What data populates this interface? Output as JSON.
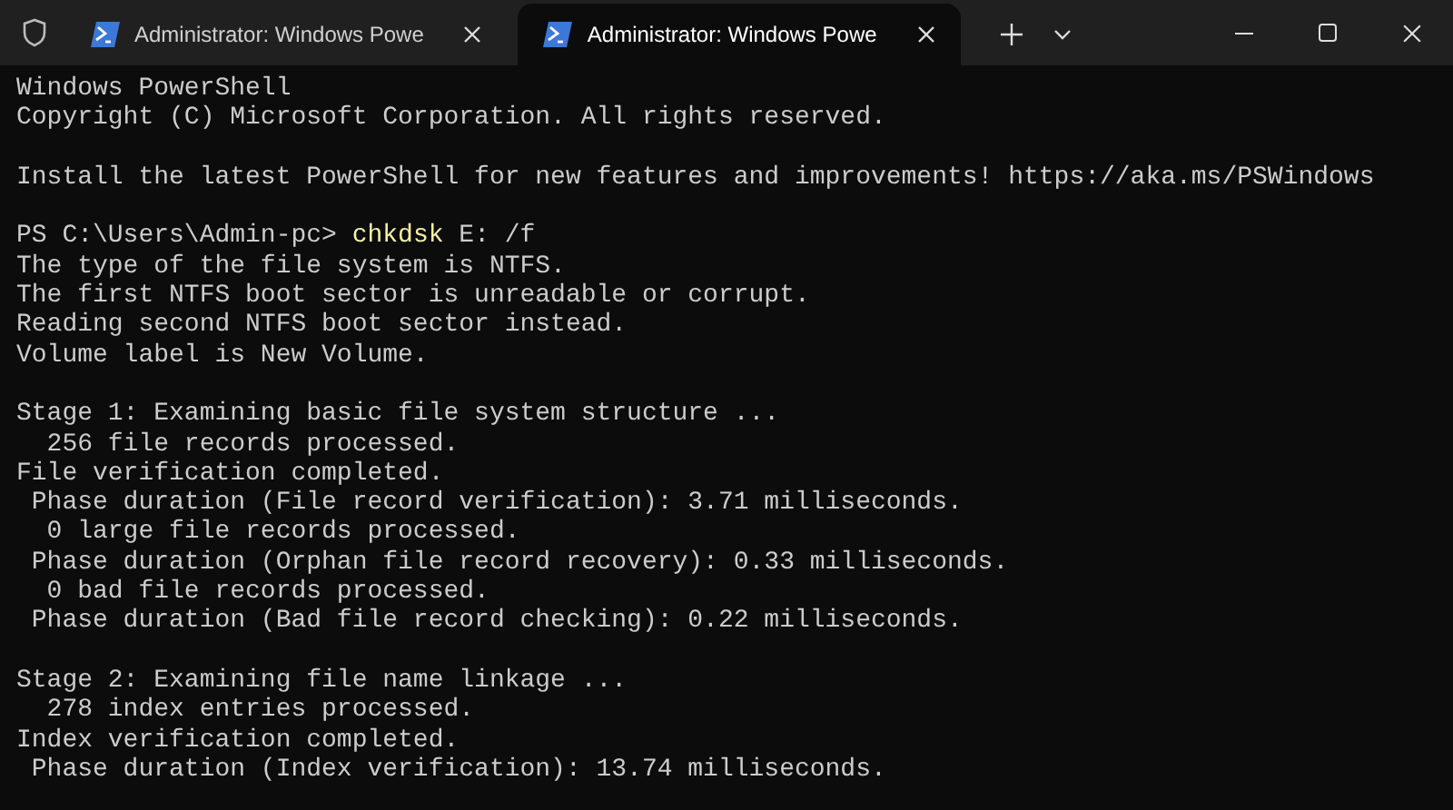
{
  "tabs": [
    {
      "title": "Administrator: Windows Powe",
      "selected": false
    },
    {
      "title": "Administrator: Windows Powe",
      "selected": true
    }
  ],
  "lines": [
    {
      "kind": "text",
      "text": "Windows PowerShell"
    },
    {
      "kind": "text",
      "text": "Copyright (C) Microsoft Corporation. All rights reserved."
    },
    {
      "kind": "blank"
    },
    {
      "kind": "text",
      "text": "Install the latest PowerShell for new features and improvements! https://aka.ms/PSWindows"
    },
    {
      "kind": "blank"
    },
    {
      "kind": "command",
      "prompt": "PS C:\\Users\\Admin-pc> ",
      "command": "chkdsk",
      "args": " E: /f"
    },
    {
      "kind": "text",
      "text": "The type of the file system is NTFS."
    },
    {
      "kind": "text",
      "text": "The first NTFS boot sector is unreadable or corrupt."
    },
    {
      "kind": "text",
      "text": "Reading second NTFS boot sector instead."
    },
    {
      "kind": "text",
      "text": "Volume label is New Volume."
    },
    {
      "kind": "blank"
    },
    {
      "kind": "text",
      "text": "Stage 1: Examining basic file system structure ..."
    },
    {
      "kind": "text",
      "text": "  256 file records processed."
    },
    {
      "kind": "text",
      "text": "File verification completed."
    },
    {
      "kind": "text",
      "text": " Phase duration (File record verification): 3.71 milliseconds."
    },
    {
      "kind": "text",
      "text": "  0 large file records processed."
    },
    {
      "kind": "text",
      "text": " Phase duration (Orphan file record recovery): 0.33 milliseconds."
    },
    {
      "kind": "text",
      "text": "  0 bad file records processed."
    },
    {
      "kind": "text",
      "text": " Phase duration (Bad file record checking): 0.22 milliseconds."
    },
    {
      "kind": "blank"
    },
    {
      "kind": "text",
      "text": "Stage 2: Examining file name linkage ..."
    },
    {
      "kind": "text",
      "text": "  278 index entries processed."
    },
    {
      "kind": "text",
      "text": "Index verification completed."
    },
    {
      "kind": "text",
      "text": " Phase duration (Index verification): 13.74 milliseconds."
    }
  ]
}
